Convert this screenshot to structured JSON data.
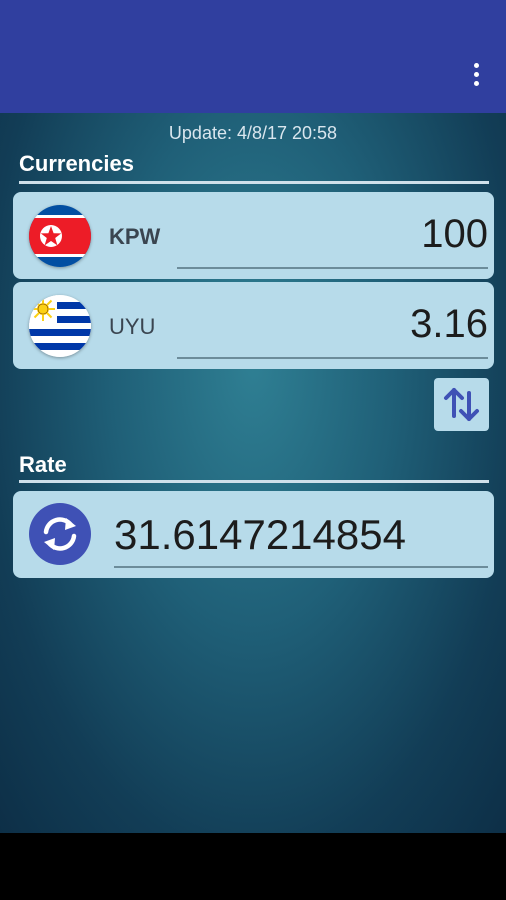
{
  "appbar": {
    "menu_icon": "more-vert-icon",
    "color": "#303f9f"
  },
  "update_text": "Update: 4/8/17 20:58",
  "currencies": {
    "title": "Currencies",
    "from": {
      "code": "KPW",
      "amount": "100",
      "flag_icon": "north-korea-flag-icon"
    },
    "to": {
      "code": "UYU",
      "amount": "3.16",
      "flag_icon": "uruguay-flag-icon"
    }
  },
  "swap_icon": "swap-vertical-arrows-icon",
  "rate": {
    "title": "Rate",
    "value": "31.6147214854",
    "icon": "refresh-icon"
  },
  "colors": {
    "card_bg": "#b7dbea",
    "accent": "#3f51b5"
  }
}
